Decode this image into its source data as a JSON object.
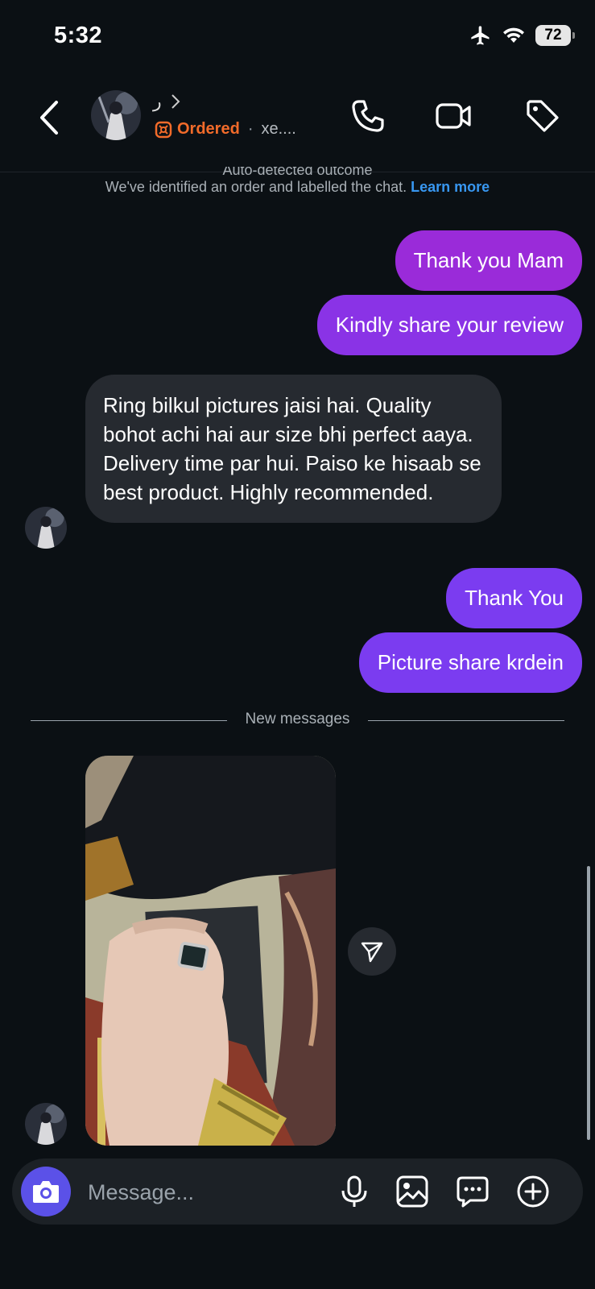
{
  "status_bar": {
    "time": "5:32",
    "battery": "72"
  },
  "header": {
    "contact_name": "ﺭ",
    "status_label": "Ordered",
    "separator": "·",
    "username": "xe...."
  },
  "system_note": {
    "title": "Auto-detected outcome",
    "text": "We've identified an order and labelled the chat.",
    "link": "Learn more"
  },
  "messages": [
    {
      "text": "Thank you Mam"
    },
    {
      "text": "Kindly share your review"
    },
    {
      "text": "Ring bilkul pictures jaisi hai. Quality bohot achi hai aur size bhi perfect aaya. Delivery time par hui. Paiso ke hisaab se best product. Highly recommended."
    },
    {
      "text": "Thank You"
    },
    {
      "text": "Picture share krdein"
    }
  ],
  "divider_label": "New messages",
  "composer": {
    "placeholder": "Message..."
  },
  "icons": {
    "back": "chevron-left-icon",
    "call": "phone-icon",
    "video": "video-camera-icon",
    "tag": "tag-icon",
    "camera": "camera-icon",
    "mic": "microphone-icon",
    "gallery": "image-icon",
    "sticker": "chat-bubble-icon",
    "more": "plus-circle-icon",
    "share": "send-icon"
  },
  "colors": {
    "accent_purple": "#8a2be2",
    "ordered_orange": "#f26b2a",
    "link_blue": "#3897f0",
    "camera_button": "#5b51e8"
  }
}
